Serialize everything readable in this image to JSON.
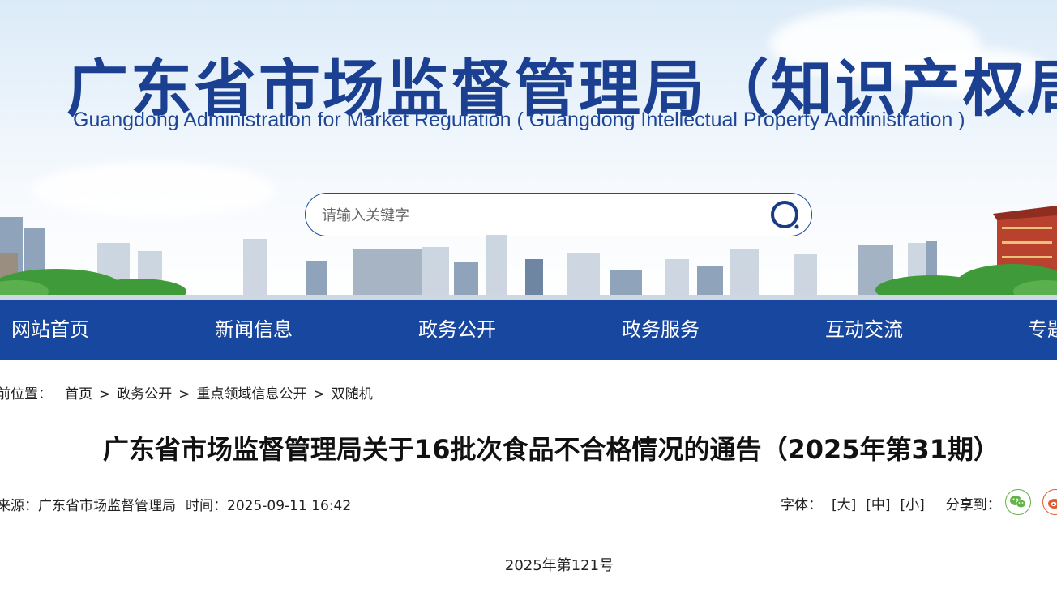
{
  "header": {
    "title_cn": "广东省市场监督管理局（知识产权局）",
    "title_en": "Guangdong Administration for Market Regulation ( Guangdong Intellectual Property Administration )",
    "search": {
      "placeholder": "请输入关键字"
    },
    "accent_color": "#1b3f91"
  },
  "nav": {
    "background": "#1847a0",
    "items": [
      "网站首页",
      "新闻信息",
      "政务公开",
      "政务服务",
      "互动交流",
      "专题"
    ]
  },
  "breadcrumb": {
    "label": "前位置：",
    "items": [
      "首页",
      "政务公开",
      "重点领域信息公开",
      "双随机"
    ],
    "separator": ">"
  },
  "article": {
    "title": "广东省市场监督管理局关于16批次食品不合格情况的通告（2025年第31期）",
    "source_label": "来源：",
    "source": "广东省市场监督管理局",
    "time_label": "时间：",
    "time": "2025-09-11 16:42",
    "font_label": "字体：",
    "font_sizes": [
      "[大]",
      "[中]",
      "[小]"
    ],
    "share_label": "分享到：",
    "share_icons": [
      "wechat-icon",
      "weibo-icon"
    ],
    "issue_no": "2025年第121号"
  }
}
